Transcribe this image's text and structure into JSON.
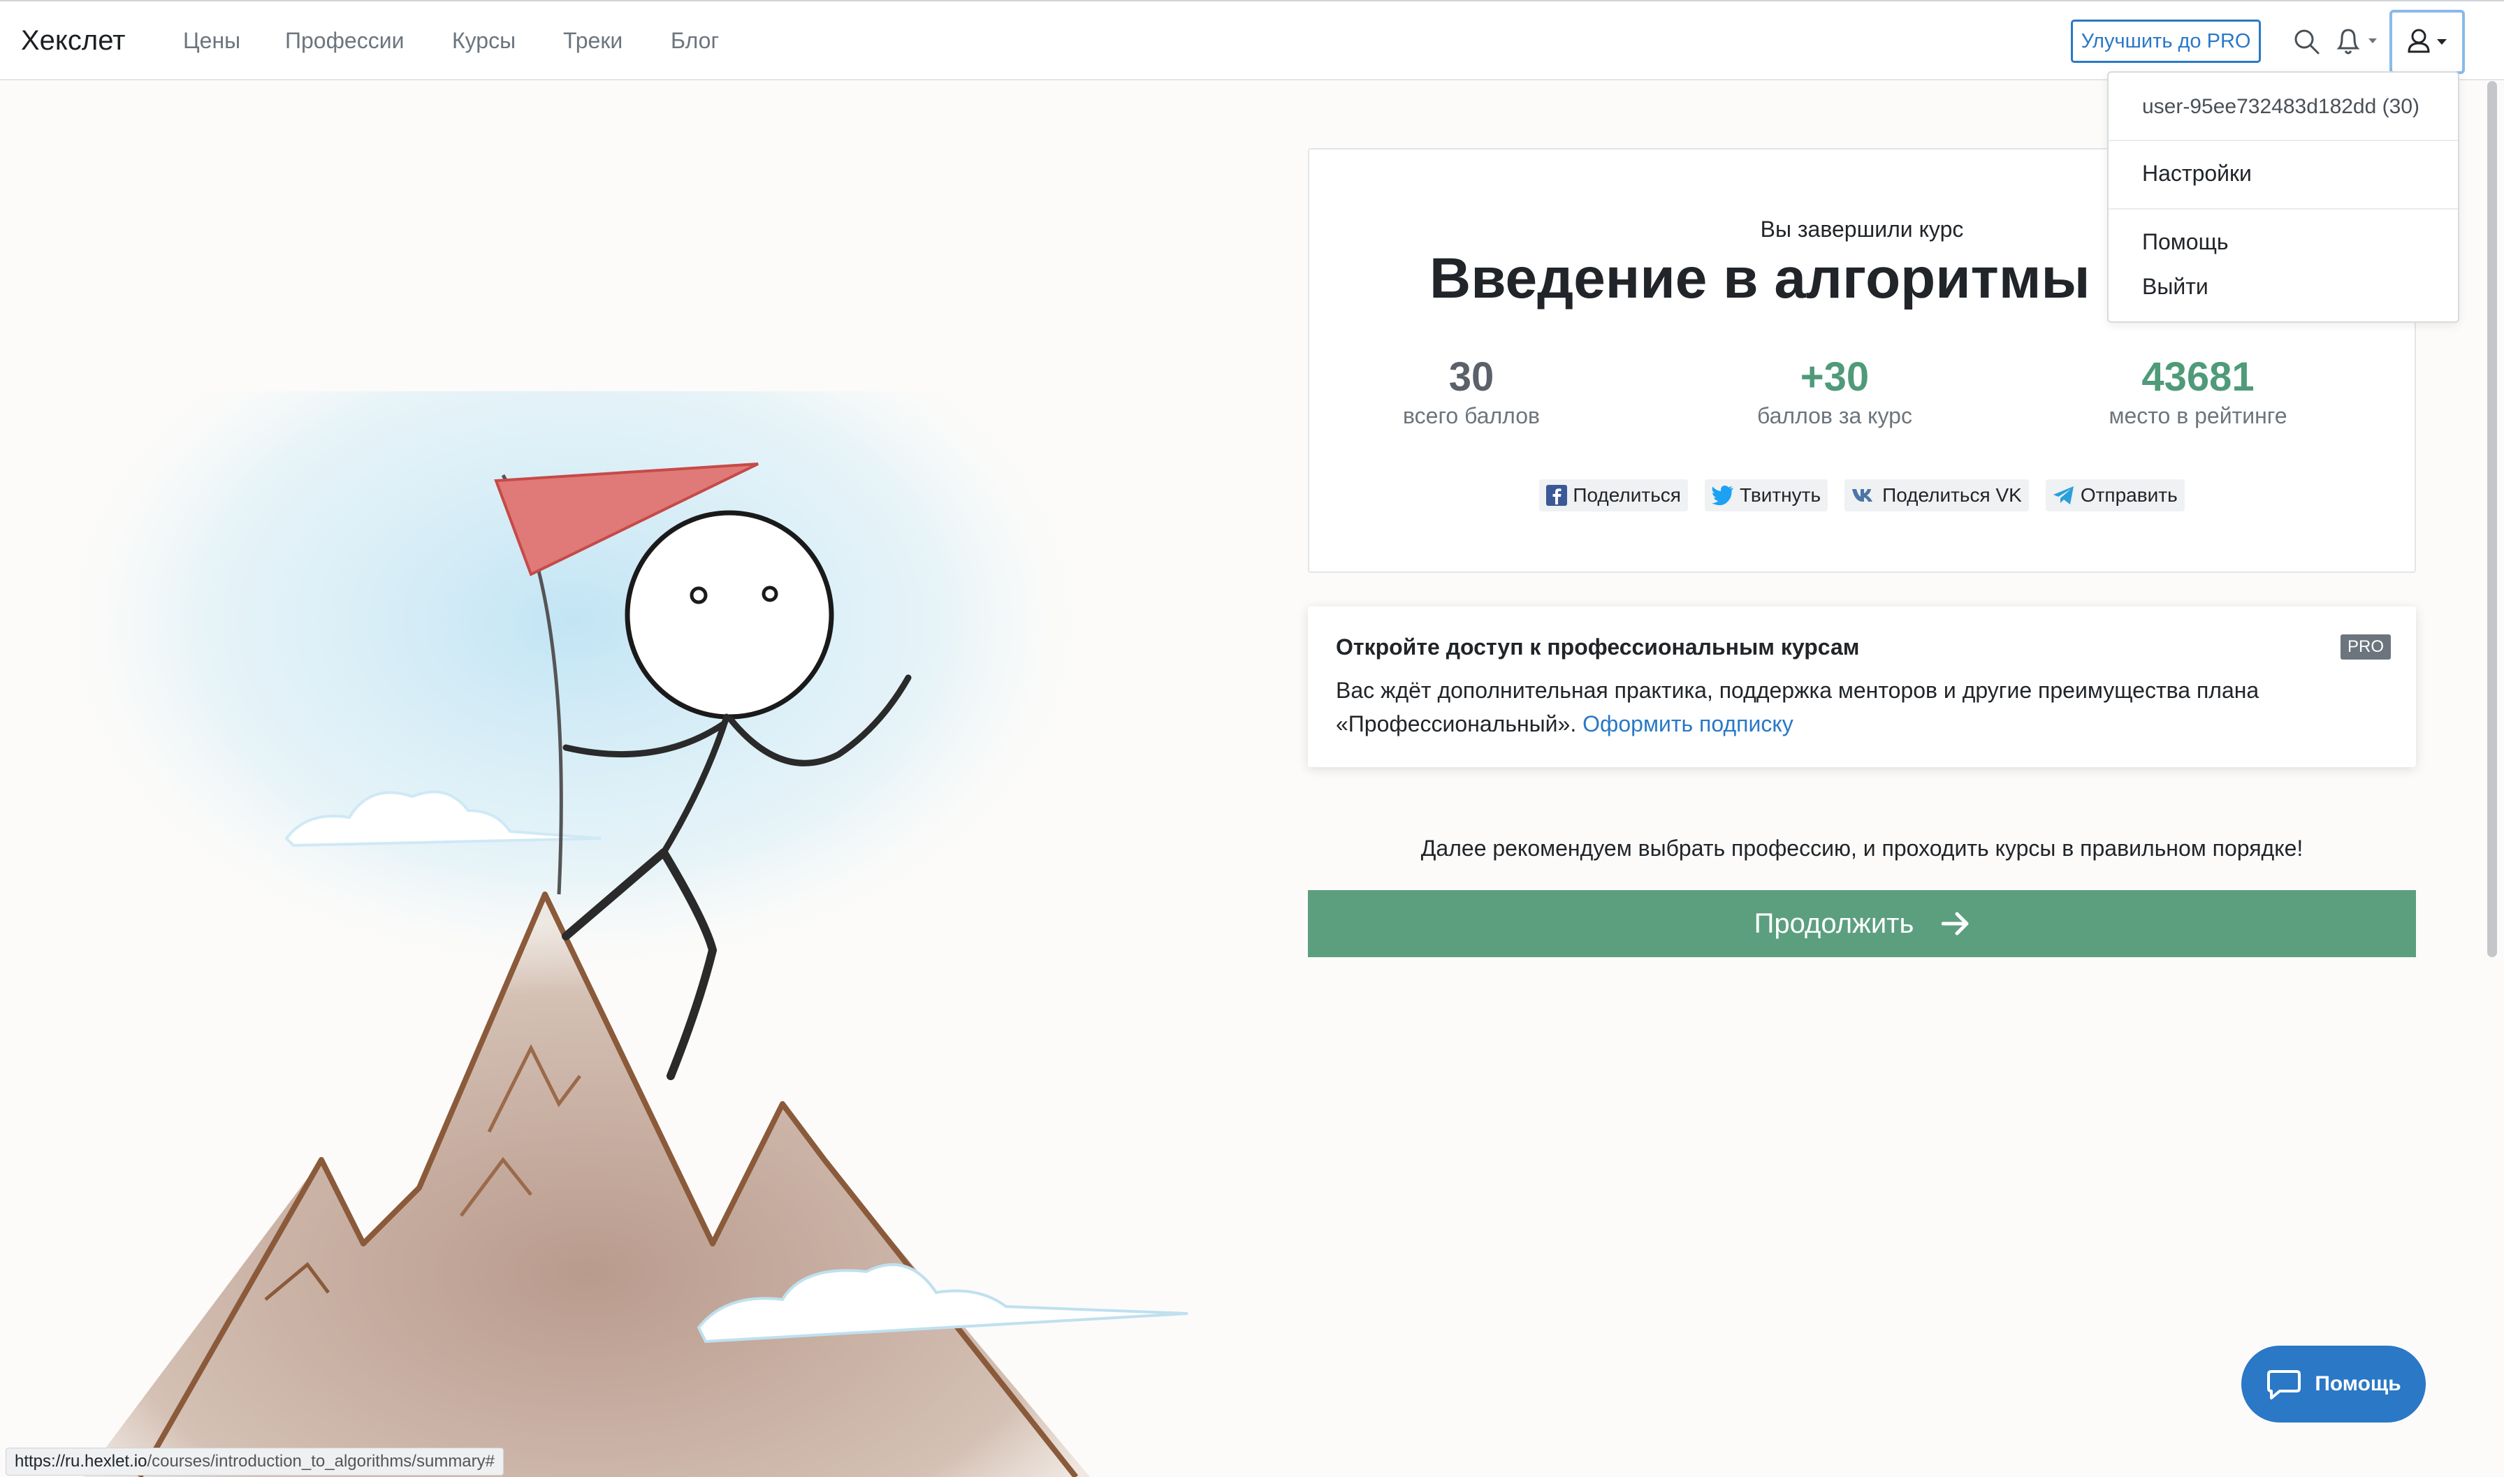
{
  "navbar": {
    "brand": "Хекслет",
    "links": [
      "Цены",
      "Профессии",
      "Курсы",
      "Треки",
      "Блог"
    ],
    "upgrade_label": "Улучшить до PRO"
  },
  "user_menu": {
    "username": "user-95ee732483d182dd (30)",
    "settings": "Настройки",
    "help": "Помощь",
    "logout": "Выйти"
  },
  "result": {
    "done_label": "Вы завершили курс",
    "course_title": "Введение в алгоритмы (Р",
    "stats": [
      {
        "value": "30",
        "label": "всего баллов",
        "color": "#5a6169"
      },
      {
        "value": "+30",
        "label": "баллов за курс",
        "color": "#4f9a79"
      },
      {
        "value": "43681",
        "label": "место в рейтинге",
        "color": "#4f9a79"
      }
    ],
    "share": [
      {
        "label": "Поделиться",
        "icon": "facebook-icon"
      },
      {
        "label": "Твитнуть",
        "icon": "twitter-icon"
      },
      {
        "label": "Поделиться VK",
        "icon": "vk-icon"
      },
      {
        "label": "Отправить",
        "icon": "telegram-icon"
      }
    ]
  },
  "pro_card": {
    "title": "Откройте доступ к профессиональным курсам",
    "badge": "PRO",
    "text": "Вас ждёт дополнительная практика, поддержка менторов и другие преимущества плана «Профессиональный».",
    "link": "Оформить подписку"
  },
  "recommend_text": "Далее рекомендуем выбрать профессию, и проходить курсы в правильном порядке!",
  "continue_label": "Продолжить",
  "help_widget_label": "Помощь",
  "status_url_host": "https://ru.hexlet.io",
  "status_url_path": "/courses/introduction_to_algorithms/summary#",
  "colors": {
    "accent_blue": "#2a78c6",
    "accent_green": "#5b9f7f"
  }
}
